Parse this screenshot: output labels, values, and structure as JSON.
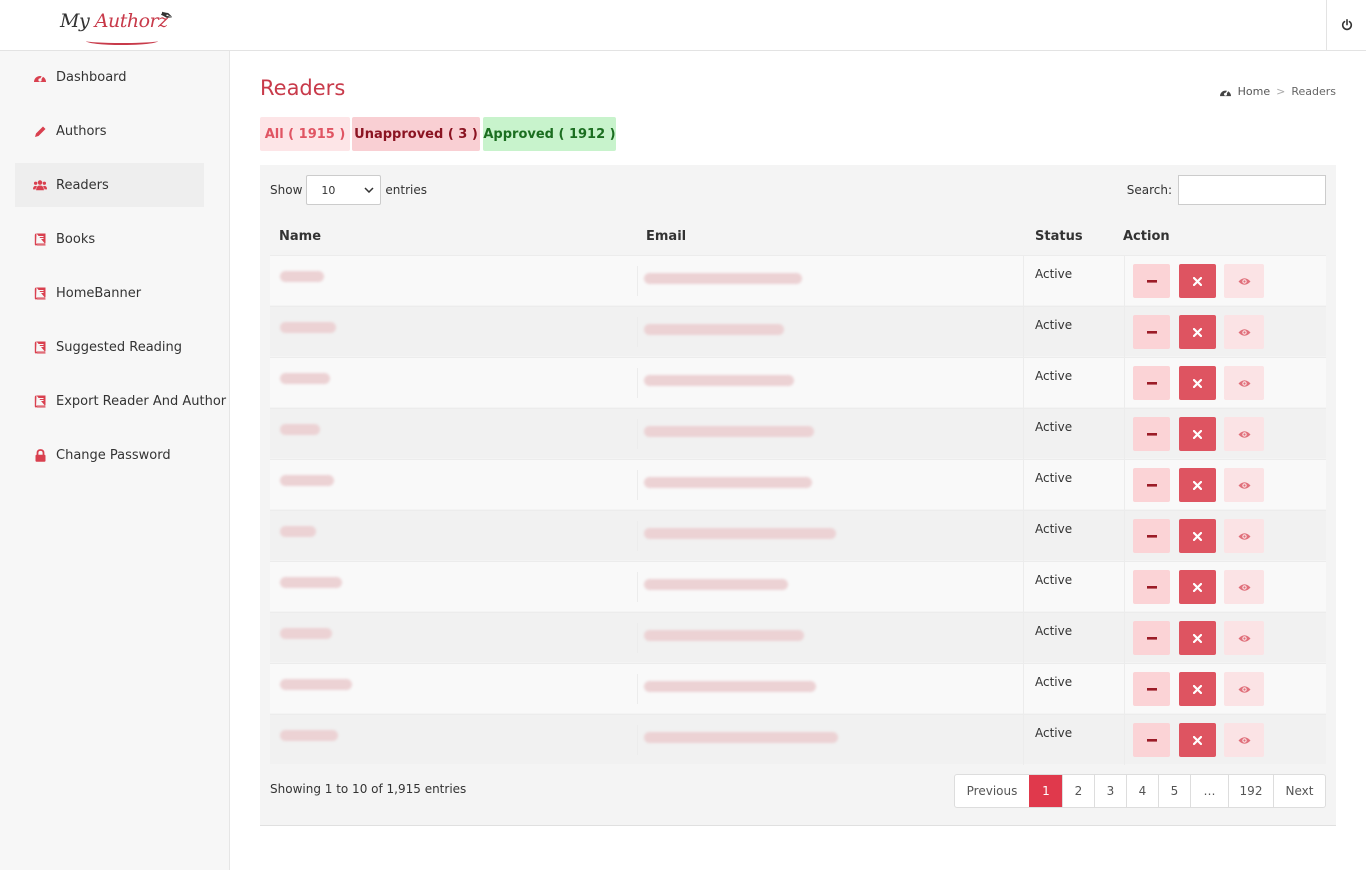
{
  "brand": {
    "logo_text_1": "My",
    "logo_text_2": "Authorz"
  },
  "header": {
    "power_icon": "power-icon"
  },
  "sidebar": {
    "items": [
      {
        "label": "Dashboard",
        "icon": "dashboard-icon"
      },
      {
        "label": "Authors",
        "icon": "pencil-icon"
      },
      {
        "label": "Readers",
        "icon": "users-icon",
        "active": true
      },
      {
        "label": "Books",
        "icon": "book-icon"
      },
      {
        "label": "HomeBanner",
        "icon": "book-icon"
      },
      {
        "label": "Suggested Reading",
        "icon": "book-icon"
      },
      {
        "label": "Export Reader And Author",
        "icon": "book-icon"
      },
      {
        "label": "Change Password",
        "icon": "lock-icon"
      }
    ]
  },
  "page": {
    "title": "Readers",
    "breadcrumb": {
      "home": "Home",
      "separator": ">",
      "current": "Readers"
    },
    "tabs": {
      "all": "All ( 1915 )",
      "unapproved": "Unapproved ( 3 )",
      "approved": "Approved ( 1912 )"
    }
  },
  "table_controls": {
    "show_label": "Show",
    "entries_value": "10",
    "entries_label": "entries",
    "search_label": "Search:",
    "search_value": ""
  },
  "table": {
    "columns": [
      "Name",
      "Email",
      "Status",
      "Action"
    ],
    "rows": [
      {
        "status": "Active"
      },
      {
        "status": "Active"
      },
      {
        "status": "Active"
      },
      {
        "status": "Active"
      },
      {
        "status": "Active"
      },
      {
        "status": "Active"
      },
      {
        "status": "Active"
      },
      {
        "status": "Active"
      },
      {
        "status": "Active"
      },
      {
        "status": "Active"
      }
    ]
  },
  "footer": {
    "info": "Showing 1 to 10 of 1,915 entries",
    "pagination": [
      "Previous",
      "1",
      "2",
      "3",
      "4",
      "5",
      "…",
      "192",
      "Next"
    ],
    "active_page": "1"
  },
  "colors": {
    "accent": "#c83a4a",
    "danger": "#de5461",
    "success_text": "#1b6e20"
  }
}
